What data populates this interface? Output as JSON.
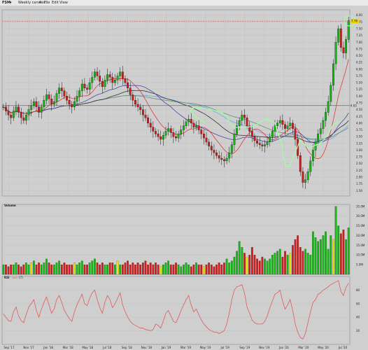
{
  "toolbar": {
    "symbol": "FSM",
    "symbol_caret": "▾",
    "interval": "Weekly candles",
    "interval_caret": "▾",
    "menus": [
      "File",
      "Edit",
      "View"
    ]
  },
  "panels": {
    "volume_label": "Volume",
    "rsi_label": "RSI",
    "rsi_param": "(7)"
  },
  "colors": {
    "up": "#12b712",
    "down": "#d21b1b",
    "volume_neutral": "#e9e900",
    "ma_red": "#e03a3a",
    "ma_navy": "#4a4aa8",
    "ma_black": "#333333",
    "ma_gray_green": "#6d8f6d",
    "ma_light_blue": "#62aee8",
    "rsi": "#e05a5a",
    "highlight": "#9fff9f",
    "price_tag": "#f2d200"
  },
  "chart_data": [
    {
      "type": "candlestick",
      "title": "FSM Weekly candles",
      "x_tick_labels": [
        "Sep '17",
        "Nov '17",
        "Jan '18",
        "Mar '18",
        "May '18",
        "Jul '18",
        "Sep '18",
        "Nov '18",
        "Jan '19",
        "Mar '19",
        "May '19",
        "Jul '19",
        "Sep '19",
        "Nov '19",
        "Jan '20",
        "Mar '20",
        "May '20",
        "Jul '20"
      ],
      "x_tick_labels_shown": [
        "Sep '17",
        "Nov '17",
        "Jan '18",
        "Mar '18",
        "May '18",
        "Jul '18",
        "Sep '18",
        "Nov '18",
        "Jan '19",
        "Mar '19",
        "May '19",
        "Jul '19",
        "Sep '19",
        "Nov '19",
        "Jan '20",
        "Mar '20",
        "May '20",
        "Jul '20"
      ],
      "y_tick_labels": [
        "1.50",
        "1.75",
        "2.00",
        "2.25",
        "2.50",
        "2.75",
        "3.00",
        "3.25",
        "3.50",
        "3.75",
        "4.00",
        "4.25",
        "4.50",
        "4.75",
        "5.00",
        "5.25",
        "5.50",
        "5.75",
        "6.00",
        "6.25",
        "6.50",
        "6.75",
        "7.00",
        "7.25",
        "7.50",
        "7.75",
        "8.00"
      ],
      "ylim": [
        1.3,
        8.2
      ],
      "last_price_label": "7.78",
      "level_label": "4.65",
      "close": [
        4.6,
        4.45,
        4.3,
        4.2,
        4.45,
        4.6,
        4.4,
        4.2,
        4.1,
        4.3,
        4.5,
        4.65,
        4.8,
        4.6,
        4.4,
        4.6,
        4.85,
        5.05,
        4.9,
        4.7,
        4.8,
        5.1,
        5.3,
        5.2,
        5.0,
        4.85,
        4.7,
        4.6,
        4.8,
        5.0,
        5.2,
        5.45,
        5.3,
        5.25,
        5.5,
        5.7,
        5.9,
        5.75,
        5.55,
        5.35,
        5.6,
        5.8,
        5.7,
        5.5,
        5.6,
        5.75,
        5.9,
        5.65,
        5.5,
        5.3,
        5.05,
        4.85,
        4.7,
        4.6,
        4.5,
        4.3,
        4.2,
        4.0,
        3.85,
        3.7,
        3.6,
        3.5,
        3.4,
        3.55,
        3.7,
        3.8,
        3.65,
        3.5,
        3.45,
        3.6,
        3.75,
        3.9,
        4.05,
        4.15,
        4.0,
        3.85,
        3.9,
        3.75,
        3.6,
        3.45,
        3.3,
        3.15,
        3.0,
        2.9,
        2.8,
        2.7,
        2.65,
        2.6,
        2.7,
        2.9,
        3.2,
        3.6,
        3.9,
        4.1,
        4.3,
        4.2,
        3.9,
        3.7,
        3.5,
        3.35,
        3.25,
        3.2,
        3.15,
        3.2,
        3.3,
        3.5,
        3.7,
        3.9,
        4.0,
        4.1,
        3.95,
        3.8,
        3.9,
        4.0,
        3.8,
        3.4,
        2.8,
        2.2,
        1.8,
        1.9,
        2.2,
        2.6,
        3.0,
        3.3,
        3.6,
        3.8,
        4.1,
        4.4,
        4.8,
        5.4,
        6.2,
        7.0,
        7.5,
        6.8,
        6.6,
        7.1,
        7.8
      ],
      "volume_ylim": [
        0,
        36000000
      ],
      "volume_tick_labels": [
        "5.0M",
        "10.0M",
        "15.0M",
        "20.0M",
        "25.0M",
        "30.0M",
        "35.0M"
      ],
      "volume": [
        5,
        5,
        4,
        5,
        5,
        6,
        5,
        4,
        5,
        6,
        5,
        6,
        7,
        5,
        6,
        5,
        6,
        8,
        6,
        5,
        5,
        6,
        7,
        5,
        6,
        5,
        5,
        5,
        6,
        5,
        6,
        7,
        5,
        5,
        6,
        7,
        8,
        6,
        5,
        6,
        5,
        5,
        6,
        6,
        5,
        7,
        5,
        5,
        6,
        7,
        5,
        6,
        5,
        6,
        5,
        6,
        7,
        5,
        6,
        5,
        6,
        5,
        4,
        5,
        6,
        7,
        5,
        5,
        6,
        5,
        4,
        5,
        6,
        5,
        4,
        5,
        6,
        5,
        5,
        4,
        5,
        6,
        5,
        4,
        5,
        6,
        5,
        6,
        8,
        6,
        7,
        9,
        12,
        17,
        14,
        11,
        9,
        10,
        14,
        10,
        8,
        7,
        9,
        8,
        7,
        8,
        10,
        11,
        12,
        13,
        9,
        12,
        10,
        11,
        15,
        18,
        20,
        14,
        12,
        13,
        11,
        10,
        22,
        19,
        17,
        18,
        20,
        22,
        13,
        20,
        18,
        35,
        25,
        21,
        23,
        18,
        24
      ]
    },
    {
      "type": "line",
      "title": "RSI (7)",
      "ylim": [
        0,
        100
      ],
      "y_tick_labels": [
        "20",
        "40",
        "60",
        "80"
      ],
      "values": [
        45,
        40,
        35,
        34,
        48,
        55,
        42,
        35,
        32,
        44,
        55,
        60,
        66,
        50,
        40,
        52,
        62,
        70,
        58,
        46,
        52,
        66,
        72,
        62,
        50,
        44,
        38,
        34,
        48,
        58,
        66,
        74,
        60,
        57,
        68,
        76,
        80,
        66,
        54,
        46,
        62,
        72,
        66,
        54,
        60,
        68,
        76,
        58,
        48,
        40,
        34,
        30,
        28,
        26,
        24,
        24,
        22,
        21,
        20,
        22,
        30,
        28,
        24,
        34,
        46,
        50,
        42,
        34,
        32,
        40,
        50,
        58,
        66,
        72,
        58,
        48,
        52,
        44,
        36,
        30,
        26,
        22,
        20,
        18,
        18,
        16,
        18,
        20,
        30,
        46,
        66,
        80,
        85,
        86,
        88,
        76,
        55,
        46,
        36,
        32,
        30,
        30,
        30,
        34,
        42,
        54,
        64,
        74,
        76,
        80,
        64,
        52,
        58,
        66,
        50,
        30,
        18,
        10,
        8,
        16,
        32,
        48,
        62,
        66,
        74,
        76,
        80,
        82,
        85,
        88,
        90,
        92,
        94,
        78,
        72,
        84,
        90
      ]
    }
  ]
}
